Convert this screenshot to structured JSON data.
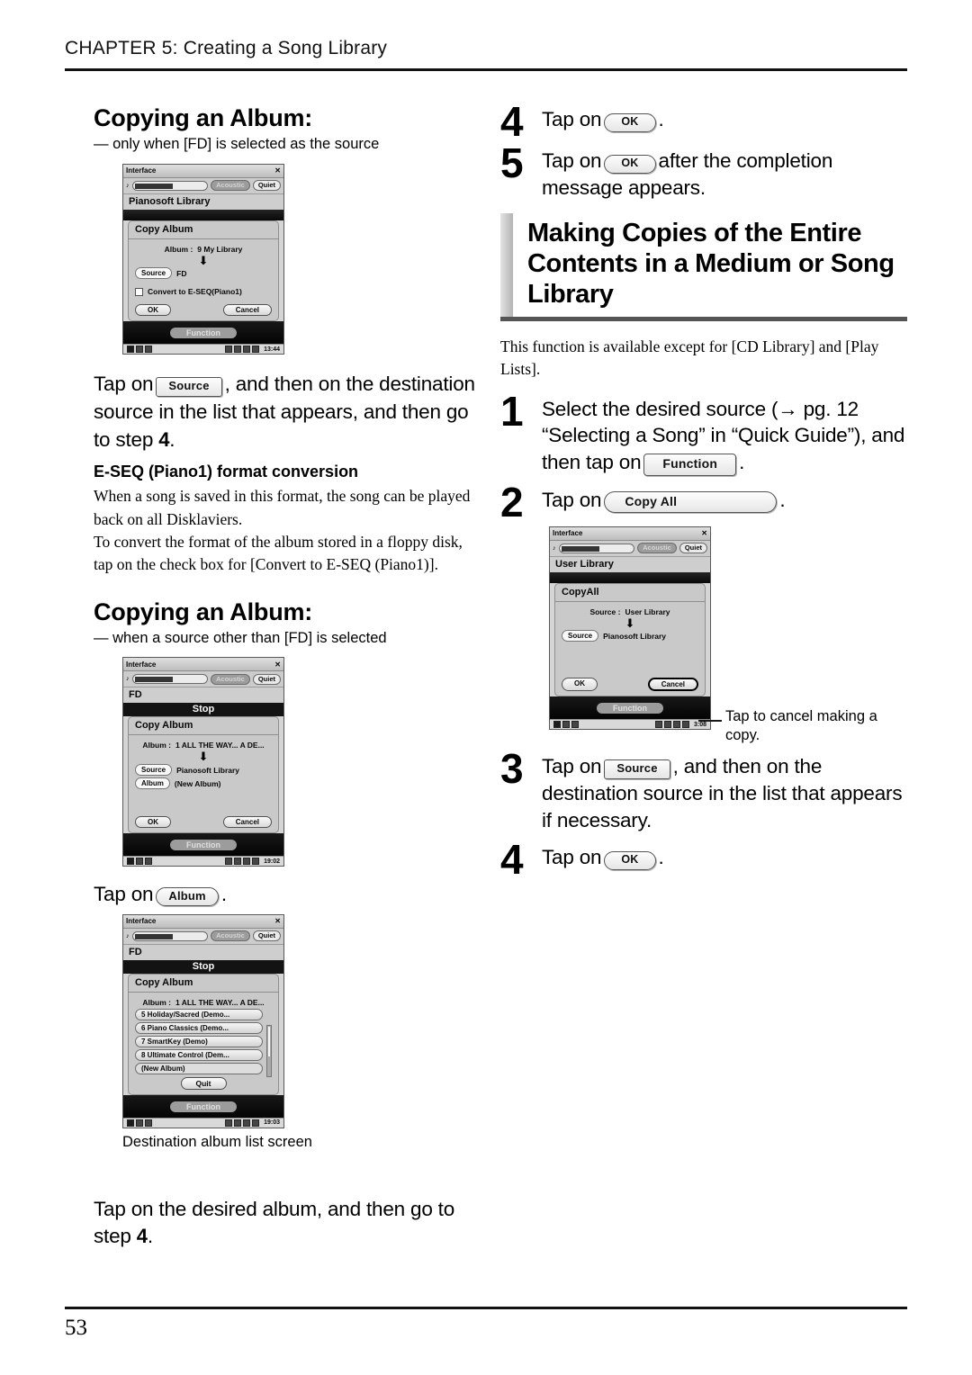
{
  "header": {
    "chapter": "CHAPTER 5: Creating a Song Library"
  },
  "footer": {
    "page_number": "53"
  },
  "left": {
    "section1": {
      "title": "Copying an Album:",
      "subtitle": "— only when [FD] is selected as the source",
      "screenshot": {
        "window_title": "Interface",
        "close_icon": "close-icon",
        "speaker_icon": "speaker-icon",
        "toggle_on": "Acoustic",
        "toggle_off": "Quiet",
        "library_label": "Pianosoft Library",
        "dialog_title": "Copy Album",
        "album_label": "Album :",
        "album_value": "9 My Library",
        "arrow_icon": "down-arrow-icon",
        "source_label": "Source",
        "source_value": "FD",
        "checkbox_icon": "checkbox-unchecked-icon",
        "checkbox_label": "Convert to E-SEQ(Piano1)",
        "ok_label": "OK",
        "cancel_label": "Cancel",
        "function_label": "Function",
        "clock": "13:44"
      },
      "instruction_a": "Tap on",
      "chip_source": "Source",
      "instruction_b": ", and then on the destination source in the list that appears, and then go to step",
      "step_ref": "4",
      "period": ".",
      "note_title": "E-SEQ (Piano1) format conversion",
      "note_body_1": "When a song is saved in this format, the song can be played back on all Disklaviers.",
      "note_body_2": "To convert the format of the album stored in a floppy disk, tap on the check box for [Convert to E-SEQ (Piano1)]."
    },
    "section2": {
      "title": "Copying an Album:",
      "subtitle": "— when a source other than [FD] is selected",
      "screenshot": {
        "window_title": "Interface",
        "toggle_on": "Acoustic",
        "toggle_off": "Quiet",
        "library_label": "FD",
        "stop_label": "Stop",
        "dialog_title": "Copy Album",
        "album_label": "Album :",
        "album_value": "1 ALL THE WAY... A DE...",
        "source_label": "Source",
        "source_value": "Pianosoft Library",
        "album2_label": "Album",
        "album2_value": "(New Album)",
        "ok_label": "OK",
        "cancel_label": "Cancel",
        "function_label": "Function",
        "clock": "19:02"
      },
      "instruction_a": "Tap on",
      "chip_album": "Album",
      "period": ".",
      "screenshot2": {
        "window_title": "Interface",
        "toggle_on": "Acoustic",
        "toggle_off": "Quiet",
        "library_label": "FD",
        "stop_label": "Stop",
        "dialog_title": "Copy Album",
        "album_label": "Album :",
        "album_value": "1 ALL THE WAY... A DE...",
        "list": [
          "5 Holiday/Sacred (Demo...",
          "6 Piano Classics (Demo...",
          "7 SmartKey (Demo)",
          "8 Ultimate Control (Dem...",
          "(New Album)"
        ],
        "quit_label": "Quit",
        "function_label": "Function",
        "clock": "19:03"
      },
      "caption": "Destination album list screen",
      "final_instruction": "Tap on the desired album, and then go to step",
      "final_step_ref": "4",
      "final_period": "."
    }
  },
  "right": {
    "step4": {
      "num": "4",
      "text_a": "Tap on",
      "chip": "OK",
      "text_b": "."
    },
    "step5": {
      "num": "5",
      "text_a": "Tap on",
      "chip": "OK",
      "text_b": "after the completion message appears."
    },
    "banner": {
      "title": "Making Copies of the Entire Contents in a Medium or Song Library"
    },
    "intro": "This function is available except for [CD Library] and [Play Lists].",
    "step1": {
      "num": "1",
      "text_a": "Select the desired source (→ pg. 12 “Selecting a Song” in “Quick Guide”), and then tap on",
      "chip": "Function",
      "text_b": "."
    },
    "step2": {
      "num": "2",
      "text_a": "Tap on",
      "chip": "Copy All",
      "text_b": "."
    },
    "screenshot": {
      "window_title": "Interface",
      "toggle_on": "Acoustic",
      "toggle_off": "Quiet",
      "library_label": "User Library",
      "dialog_title": "CopyAll",
      "source_label": "Source :",
      "source_value": "User Library",
      "source2_label": "Source",
      "source2_value": "Pianosoft Library",
      "ok_label": "OK",
      "cancel_label": "Cancel",
      "function_label": "Function",
      "clock": "3:08"
    },
    "callout": "Tap to cancel making a copy.",
    "step3": {
      "num": "3",
      "text_a": "Tap on",
      "chip": "Source",
      "text_b": ", and then on the destination source in the list that appears if necessary."
    },
    "step4b": {
      "num": "4",
      "text_a": "Tap on",
      "chip": "OK",
      "text_b": "."
    }
  }
}
